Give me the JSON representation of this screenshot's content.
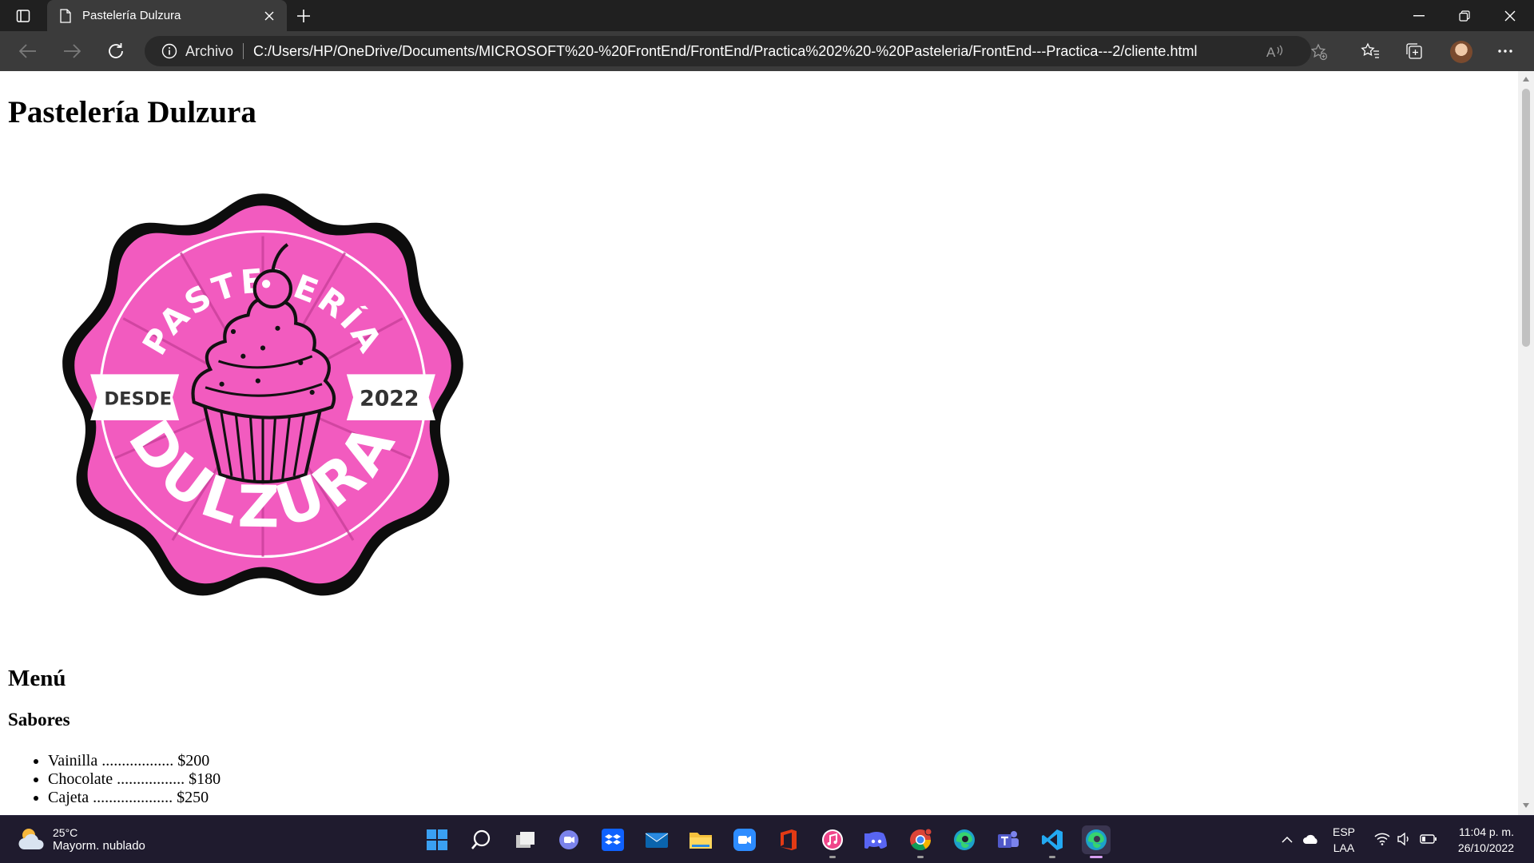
{
  "browser": {
    "tab_title": "Pastelería Dulzura",
    "address_scheme": "Archivo",
    "url": "C:/Users/HP/OneDrive/Documents/MICROSOFT%20-%20FrontEnd/FrontEnd/Practica%202%20-%20Pasteleria/FrontEnd---Practica---2/cliente.html"
  },
  "page": {
    "title": "Pastelería Dulzura",
    "menu_heading": "Menú",
    "flavors_heading": "Sabores",
    "flavors": [
      {
        "text": "Vainilla .................. $200"
      },
      {
        "text": "Chocolate ................. $180"
      },
      {
        "text": "Cajeta .................... $250"
      }
    ]
  },
  "logo": {
    "top_text": "PASTELERÍA",
    "bottom_text": "DULZURA",
    "left_banner": "DESDE",
    "right_banner": "2022",
    "colors": {
      "badge_pink": "#f25bbf",
      "outline": "#0d0d0d",
      "banner": "#ffffff",
      "banner_text": "#333333"
    }
  },
  "taskbar": {
    "weather_temp": "25°C",
    "weather_condition": "Mayorm. nublado",
    "lang_top": "ESP",
    "lang_bottom": "LAA",
    "time": "11:04 p. m.",
    "date": "26/10/2022"
  }
}
